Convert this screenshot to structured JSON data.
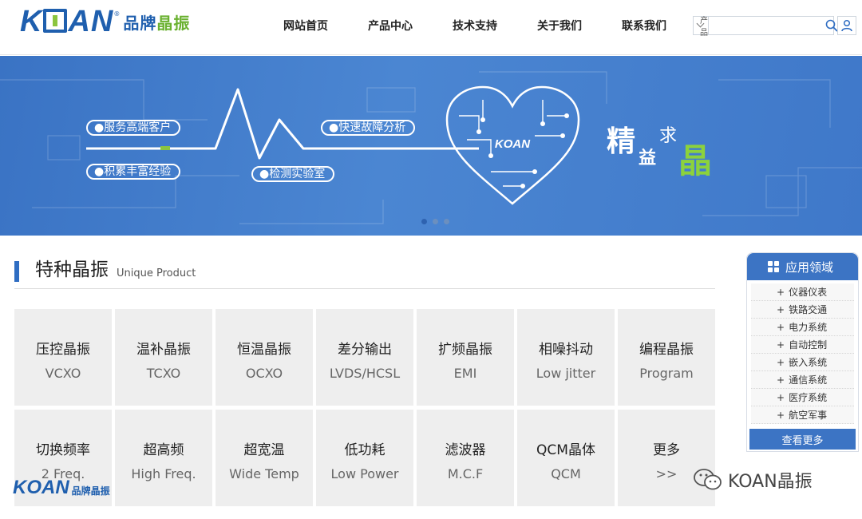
{
  "brand": {
    "logo_text": "KOAN",
    "logo_cn_a": "品牌",
    "logo_cn_b": "晶振"
  },
  "nav": {
    "items": [
      "网站首页",
      "产品中心",
      "技术支持",
      "关于我们",
      "联系我们"
    ]
  },
  "search": {
    "category": "产品",
    "placeholder": ""
  },
  "banner": {
    "pills": [
      "服务高端客户",
      "积累丰富经验",
      "检测实验室",
      "快速故障分析"
    ],
    "heart_label": "KOAN",
    "tagline_1": "精",
    "tagline_2": "益",
    "tagline_3": "求",
    "tagline_4": "晶",
    "slide_count": 3,
    "active_slide": 1
  },
  "section": {
    "title_cn": "特种晶振",
    "title_en": "Unique Product"
  },
  "products": [
    {
      "cn": "压控晶振",
      "en": "VCXO"
    },
    {
      "cn": "温补晶振",
      "en": "TCXO"
    },
    {
      "cn": "恒温晶振",
      "en": "OCXO"
    },
    {
      "cn": "差分输出",
      "en": "LVDS/HCSL"
    },
    {
      "cn": "扩频晶振",
      "en": "EMI"
    },
    {
      "cn": "相噪抖动",
      "en": "Low jitter"
    },
    {
      "cn": "编程晶振",
      "en": "Program"
    },
    {
      "cn": "切换频率",
      "en": "2 Freq."
    },
    {
      "cn": "超高频",
      "en": "High Freq."
    },
    {
      "cn": "超宽温",
      "en": "Wide Temp"
    },
    {
      "cn": "低功耗",
      "en": "Low Power"
    },
    {
      "cn": "滤波器",
      "en": "M.C.F"
    },
    {
      "cn": "QCM晶体",
      "en": "QCM"
    },
    {
      "cn": "更多",
      "en": ">>"
    }
  ],
  "side": {
    "title": "应用领域",
    "items": [
      "仪器仪表",
      "铁路交通",
      "电力系统",
      "自动控制",
      "嵌入系统",
      "通信系统",
      "医疗系统",
      "航空军事"
    ],
    "more_label": "查看更多"
  },
  "watermark": {
    "logo_text": "KOAN",
    "logo_cn": "品牌晶振",
    "wechat_text": "KOAN晶振"
  },
  "colors": {
    "brand_blue": "#1f5fae",
    "brand_green": "#6ab130",
    "panel_blue": "#3c74c4"
  }
}
